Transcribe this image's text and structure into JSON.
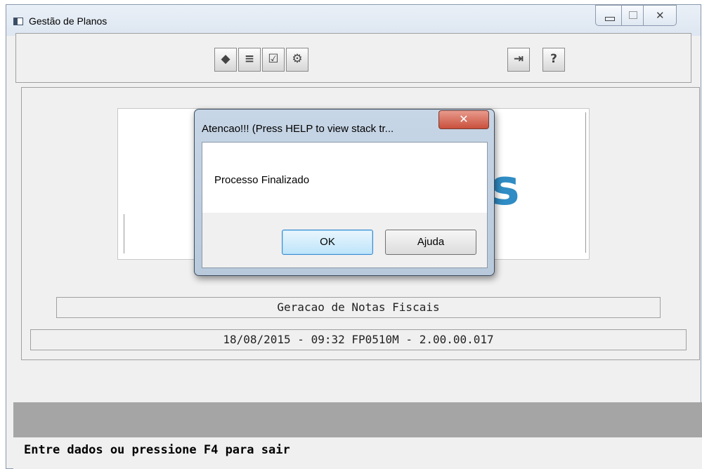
{
  "window": {
    "title": "Gestão de Planos",
    "controls": {
      "minimize": "minimize",
      "maximize": "maximize",
      "close": "✕"
    }
  },
  "toolbar": {
    "icons": [
      {
        "name": "tag-icon",
        "glyph": "◆"
      },
      {
        "name": "list-icon",
        "glyph": "≡"
      },
      {
        "name": "checklist-icon",
        "glyph": "☑"
      },
      {
        "name": "grid-settings-icon",
        "glyph": "⚙"
      },
      {
        "name": "exit-icon",
        "glyph": "⇥"
      },
      {
        "name": "help-icon",
        "glyph": "?"
      }
    ]
  },
  "splash": {
    "visible_letter": "s",
    "accent_color": "#2f8cc4"
  },
  "info": {
    "program_title": "Geracao de Notas Fiscais",
    "version_line": "18/08/2015 - 09:32  FP0510M - 2.00.00.017"
  },
  "statusbar": {
    "text": "Entre dados ou pressione F4 para sair"
  },
  "dialog": {
    "title": "Atencao!!! (Press HELP to view stack tr...",
    "close_glyph": "✕",
    "message": "Processo Finalizado",
    "ok_label": "OK",
    "help_label": "Ajuda"
  }
}
